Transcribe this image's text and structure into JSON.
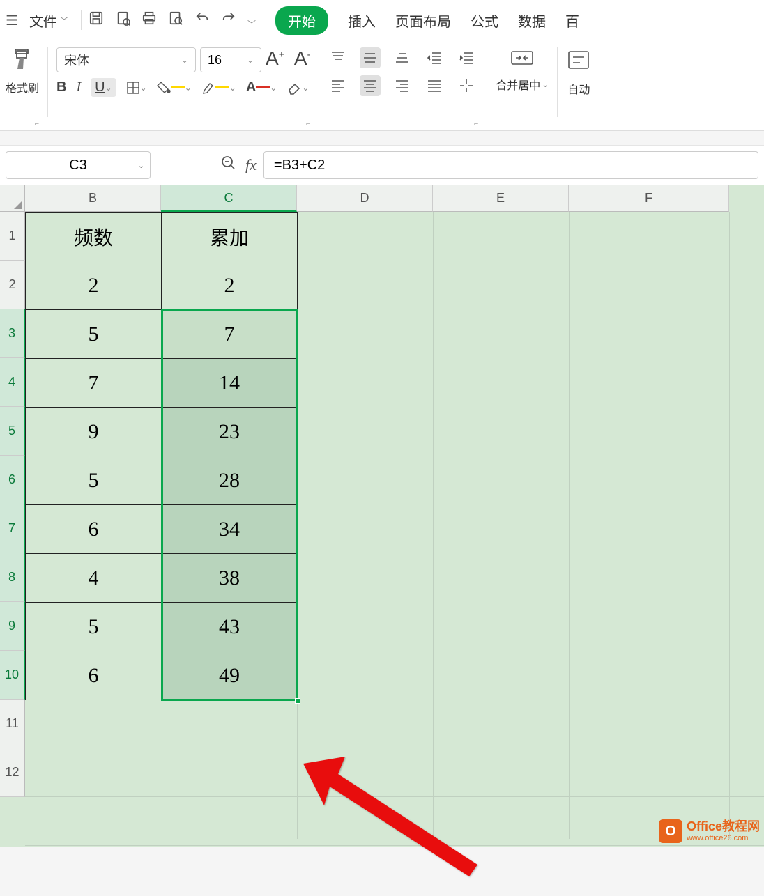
{
  "menubar": {
    "file_label": "文件"
  },
  "tabs": {
    "start": "开始",
    "insert": "插入",
    "layout": "页面布局",
    "formula": "公式",
    "data": "数据",
    "more": "百"
  },
  "ribbon": {
    "format_painter": "格式刷",
    "font_name": "宋体",
    "font_size": "16",
    "merge_center": "合并居中",
    "auto_wrap": "自动"
  },
  "namebox": "C3",
  "formula": "=B3+C2",
  "columns": [
    "B",
    "C",
    "D",
    "E",
    "F"
  ],
  "rows": [
    "1",
    "2",
    "3",
    "4",
    "5",
    "6",
    "7",
    "8",
    "9",
    "10",
    "11",
    "12"
  ],
  "headers": {
    "b": "频数",
    "c": "累加"
  },
  "data": {
    "b": [
      "2",
      "5",
      "7",
      "9",
      "5",
      "6",
      "4",
      "5",
      "6"
    ],
    "c": [
      "2",
      "7",
      "14",
      "23",
      "28",
      "34",
      "38",
      "43",
      "49"
    ]
  },
  "watermark": {
    "title": "Office教程网",
    "url": "www.office26.com"
  }
}
